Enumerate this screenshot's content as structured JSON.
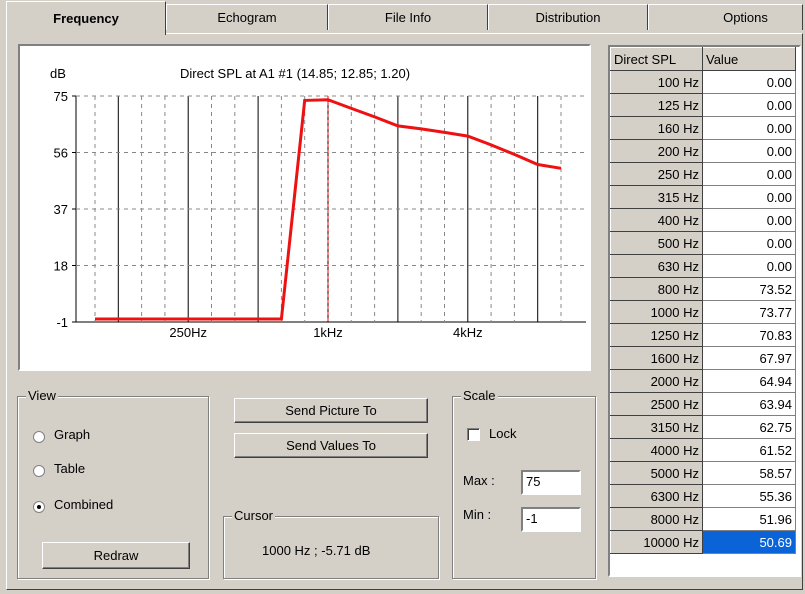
{
  "tabs": [
    "Frequency",
    "Echogram",
    "File Info",
    "Distribution",
    "Options"
  ],
  "active_tab": "Frequency",
  "chart_data": {
    "type": "line",
    "title": "Direct SPL at A1 #1  (14.85; 12.85; 1.20)",
    "ylabel": "dB",
    "yticks": [
      "75",
      "56",
      "37",
      "18",
      "-1"
    ],
    "ylim": [
      -1,
      75
    ],
    "xticks": [
      "250Hz",
      "1kHz",
      "4kHz"
    ],
    "x": [
      "100 Hz",
      "125 Hz",
      "160 Hz",
      "200 Hz",
      "250 Hz",
      "315 Hz",
      "400 Hz",
      "500 Hz",
      "630 Hz",
      "800 Hz",
      "1000 Hz",
      "1250 Hz",
      "1600 Hz",
      "2000 Hz",
      "2500 Hz",
      "3150 Hz",
      "4000 Hz",
      "5000 Hz",
      "6300 Hz",
      "8000 Hz",
      "10000 Hz"
    ],
    "series": [
      {
        "values": [
          0.0,
          0.0,
          0.0,
          0.0,
          0.0,
          0.0,
          0.0,
          0.0,
          0.0,
          73.52,
          73.77,
          70.83,
          67.97,
          64.94,
          63.94,
          62.75,
          61.52,
          58.57,
          55.36,
          51.96,
          50.69
        ]
      }
    ],
    "cursor_x": "1kHz",
    "line_color": "#ee1111",
    "grid": true
  },
  "table": {
    "headers": [
      "Direct SPL",
      "Value"
    ],
    "rows": [
      [
        "100 Hz",
        "0.00"
      ],
      [
        "125 Hz",
        "0.00"
      ],
      [
        "160 Hz",
        "0.00"
      ],
      [
        "200 Hz",
        "0.00"
      ],
      [
        "250 Hz",
        "0.00"
      ],
      [
        "315 Hz",
        "0.00"
      ],
      [
        "400 Hz",
        "0.00"
      ],
      [
        "500 Hz",
        "0.00"
      ],
      [
        "630 Hz",
        "0.00"
      ],
      [
        "800 Hz",
        "73.52"
      ],
      [
        "1000 Hz",
        "73.77"
      ],
      [
        "1250 Hz",
        "70.83"
      ],
      [
        "1600 Hz",
        "67.97"
      ],
      [
        "2000 Hz",
        "64.94"
      ],
      [
        "2500 Hz",
        "63.94"
      ],
      [
        "3150 Hz",
        "62.75"
      ],
      [
        "4000 Hz",
        "61.52"
      ],
      [
        "5000 Hz",
        "58.57"
      ],
      [
        "6300 Hz",
        "55.36"
      ],
      [
        "8000 Hz",
        "51.96"
      ],
      [
        "10000 Hz",
        "50.69"
      ]
    ],
    "selected_row": 20
  },
  "view": {
    "label": "View",
    "options": [
      "Graph",
      "Table",
      "Combined"
    ],
    "selected": "Combined",
    "redraw": "Redraw"
  },
  "buttons": {
    "send_picture": "Send Picture To",
    "send_values": "Send Values To"
  },
  "cursor": {
    "label": "Cursor",
    "value": "1000 Hz ; -5.71 dB"
  },
  "scale": {
    "label": "Scale",
    "lock_label": "Lock",
    "lock_checked": false,
    "max_label": "Max :",
    "max_value": "75",
    "min_label": "Min :",
    "min_value": "-1"
  }
}
